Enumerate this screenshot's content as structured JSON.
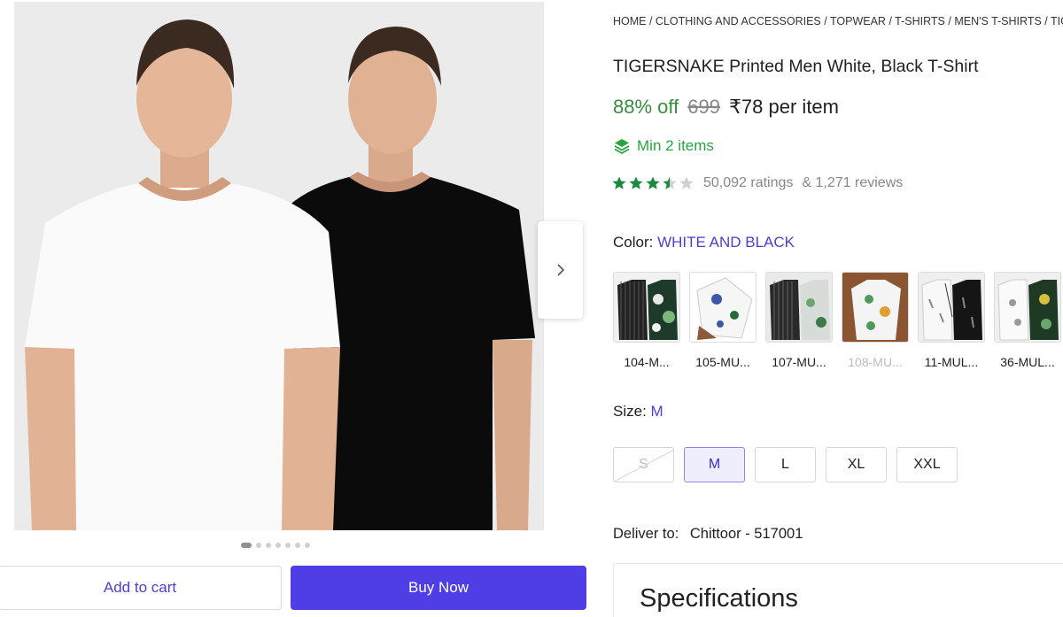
{
  "breadcrumb": [
    "HOME",
    "CLOTHING AND ACCESSORIES",
    "TOPWEAR",
    "T-SHIRTS",
    "MEN'S T-SHIRTS",
    "TIG"
  ],
  "product": {
    "title": "TIGERSNAKE Printed Men White, Black T-Shirt",
    "discount": "88% off",
    "mrp": "699",
    "price": "₹78 per item",
    "min_items": "Min 2 items",
    "rating_value": 3.5,
    "ratings": "50,092 ratings",
    "reviews": "& 1,271 reviews"
  },
  "gallery": {
    "image_count": 7,
    "active_index": 0
  },
  "color": {
    "label": "Color:",
    "selected": "WHITE AND BLACK",
    "options": [
      {
        "label": "104-M...",
        "disabled": false
      },
      {
        "label": "105-MU...",
        "disabled": false
      },
      {
        "label": "107-MU...",
        "disabled": false
      },
      {
        "label": "108-MU...",
        "disabled": true
      },
      {
        "label": "11-MUL...",
        "disabled": false
      },
      {
        "label": "36-MUL...",
        "disabled": false
      }
    ]
  },
  "size": {
    "label": "Size:",
    "selected": "M",
    "options": [
      {
        "label": "S",
        "disabled": true
      },
      {
        "label": "M",
        "selected": true
      },
      {
        "label": "L"
      },
      {
        "label": "XL"
      },
      {
        "label": "XXL"
      }
    ]
  },
  "delivery": {
    "label": "Deliver to:",
    "location": "Chittoor - 517001"
  },
  "specs": {
    "title": "Specifications"
  },
  "actions": {
    "add_to_cart": "Add to cart",
    "buy_now": "Buy Now"
  },
  "colors": {
    "brand": "#4f3ee6",
    "discount_green": "#388e3c",
    "min_items_green": "#26a541",
    "star_green": "#1b8a3a"
  },
  "icons": {
    "next": "chevron-right-icon",
    "min_items": "layers-icon",
    "rating": "star-icon"
  }
}
